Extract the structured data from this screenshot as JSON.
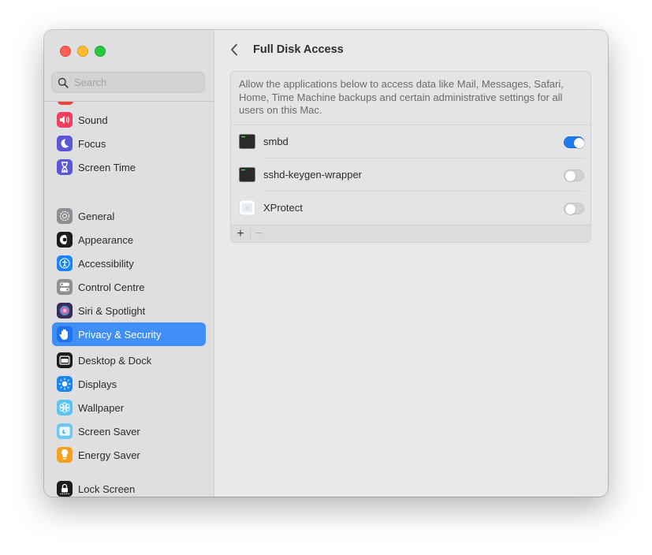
{
  "window": {
    "traffic_lights": [
      "close",
      "minimize",
      "zoom"
    ]
  },
  "sidebar": {
    "search": {
      "placeholder": "Search",
      "value": ""
    },
    "groups": [
      {
        "items": [
          {
            "label": "Sound",
            "icon": "speaker-icon",
            "color": "#f0405f"
          },
          {
            "label": "Focus",
            "icon": "moon-icon",
            "color": "#5a57d6"
          },
          {
            "label": "Screen Time",
            "icon": "hourglass-icon",
            "color": "#5a57d6"
          }
        ]
      },
      {
        "items": [
          {
            "label": "General",
            "icon": "gear-icon",
            "color": "#8e8e93"
          },
          {
            "label": "Appearance",
            "icon": "appearance-icon",
            "color": "#1c1c1e"
          },
          {
            "label": "Accessibility",
            "icon": "accessibility-icon",
            "color": "#1a84f5"
          },
          {
            "label": "Control Centre",
            "icon": "toggles-icon",
            "color": "#8e8e93"
          },
          {
            "label": "Siri & Spotlight",
            "icon": "siri-icon",
            "color": "#3a2a5a"
          },
          {
            "label": "Privacy & Security",
            "icon": "hand-icon",
            "color": "#1e6ff2",
            "selected": true
          }
        ]
      },
      {
        "items": [
          {
            "label": "Desktop & Dock",
            "icon": "dock-icon",
            "color": "#1c1c1e"
          },
          {
            "label": "Displays",
            "icon": "sun-icon",
            "color": "#1a84f5"
          },
          {
            "label": "Wallpaper",
            "icon": "flower-icon",
            "color": "#5ac4f5"
          },
          {
            "label": "Screen Saver",
            "icon": "screensaver-icon",
            "color": "#6ec8f0"
          },
          {
            "label": "Energy Saver",
            "icon": "bulb-icon",
            "color": "#f7a01e"
          }
        ]
      },
      {
        "items": [
          {
            "label": "Lock Screen",
            "icon": "lock-icon",
            "color": "#1c1c1e"
          }
        ]
      }
    ]
  },
  "main": {
    "back_label": "Back",
    "title": "Full Disk Access",
    "description": "Allow the applications below to access data like Mail, Messages, Safari, Home, Time Machine backups and certain administrative settings for all users on this Mac.",
    "apps": [
      {
        "name": "smbd",
        "icon": "terminal-icon",
        "enabled": true
      },
      {
        "name": "sshd-keygen-wrapper",
        "icon": "terminal-icon",
        "enabled": false
      },
      {
        "name": "XProtect",
        "icon": "xprotect-icon",
        "enabled": false
      }
    ],
    "footer": {
      "add_label": "+",
      "remove_label": "−"
    },
    "accent_color": "#1f7bf0"
  }
}
